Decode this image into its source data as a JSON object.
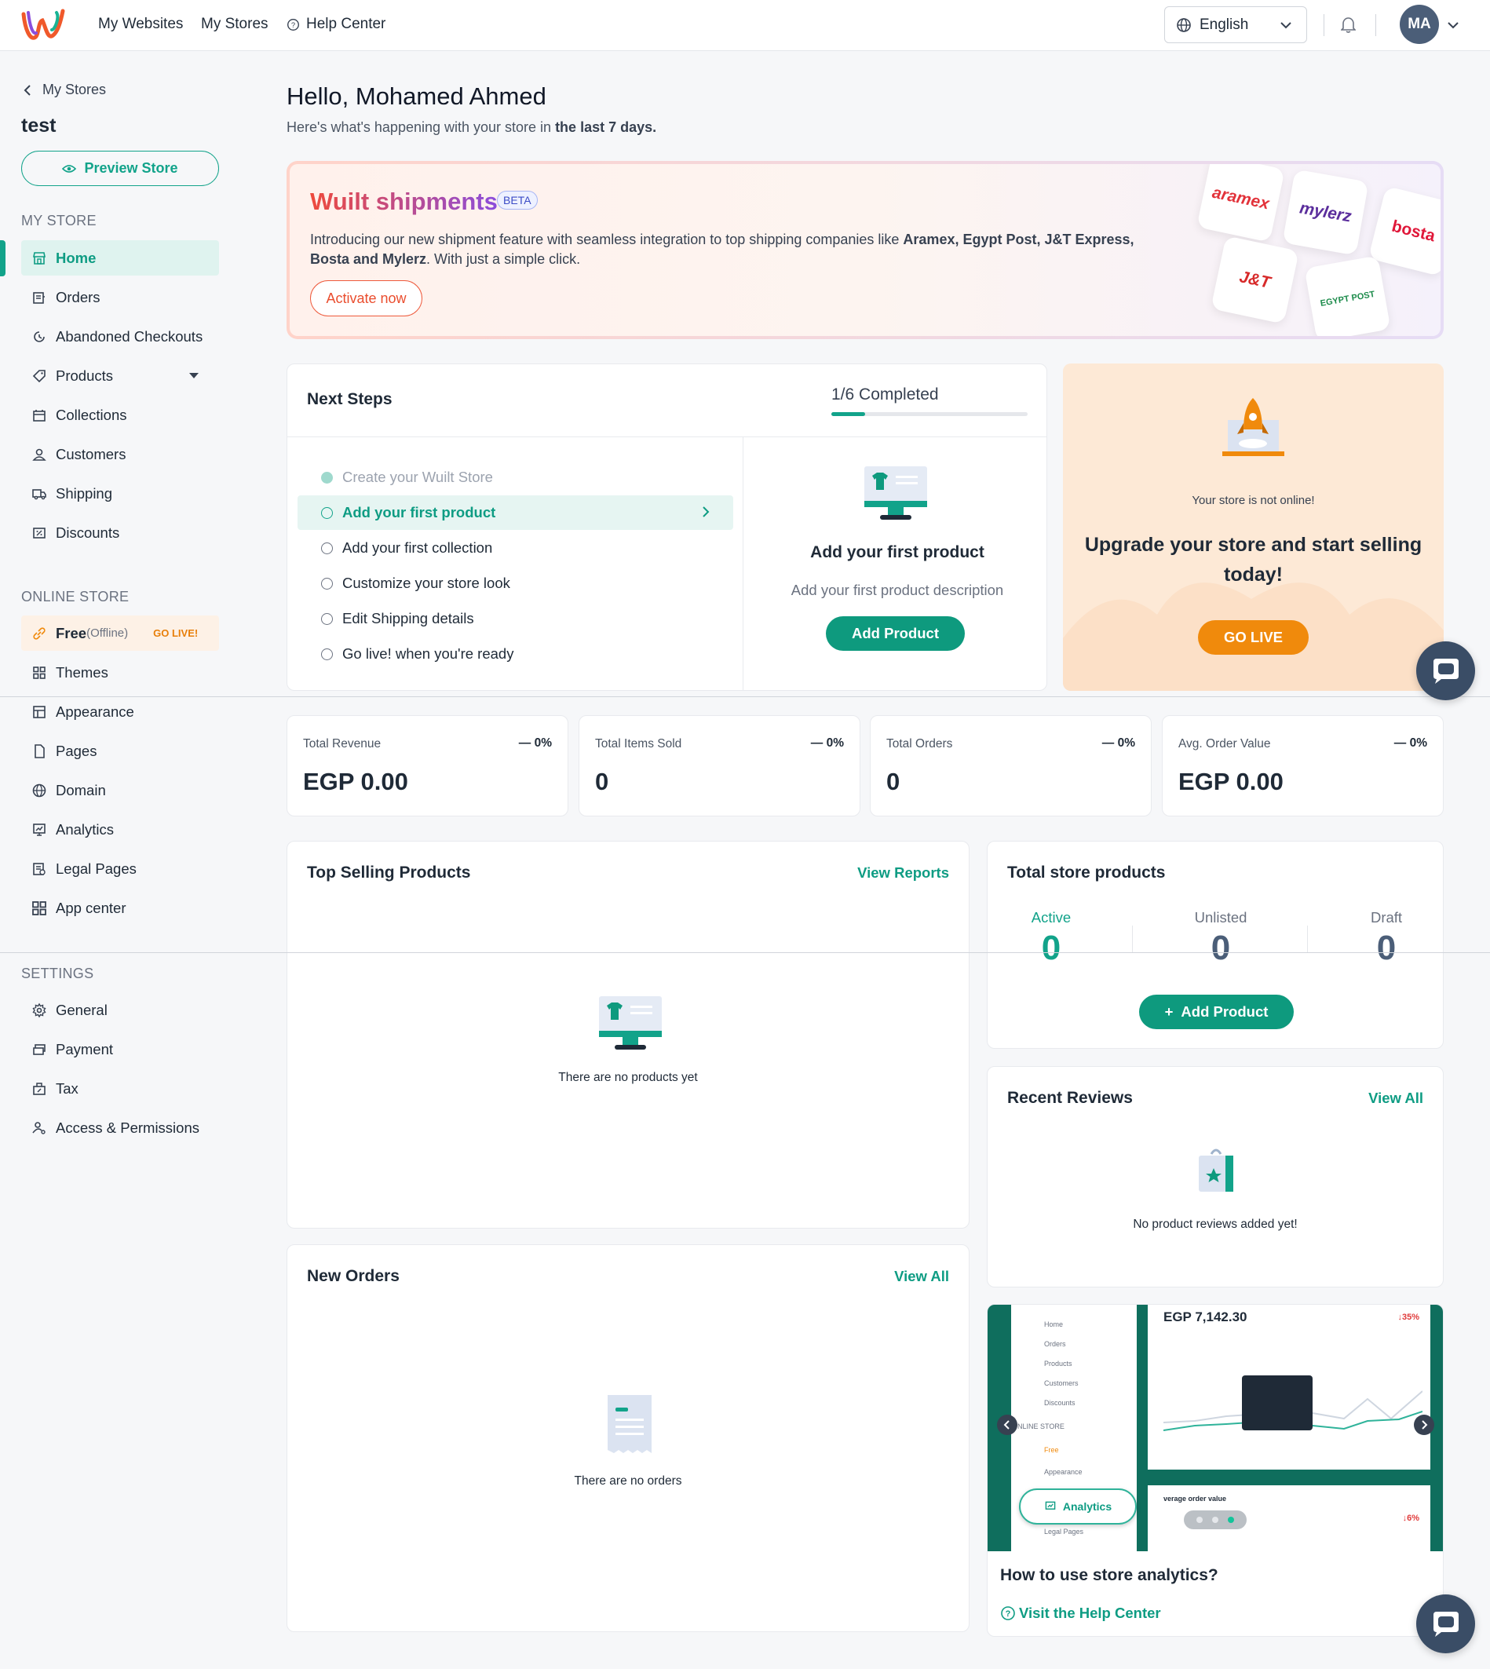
{
  "topbar": {
    "nav": [
      "My Websites",
      "My Stores",
      "Help Center"
    ],
    "language": "English",
    "avatar_initials": "MA"
  },
  "sidebar": {
    "back_label": "My Stores",
    "store_name": "test",
    "preview_label": "Preview Store",
    "my_store_heading": "MY STORE",
    "online_store_heading": "ONLINE STORE",
    "settings_heading": "SETTINGS",
    "my_store": [
      "Home",
      "Orders",
      "Abandoned Checkouts",
      "Products",
      "Collections",
      "Customers",
      "Shipping",
      "Discounts"
    ],
    "free_label": "Free",
    "offline_label": "(Offline)",
    "go_live_badge": "GO LIVE!",
    "online_store": [
      "Themes",
      "Appearance",
      "Pages",
      "Domain",
      "Analytics",
      "Legal Pages",
      "App center"
    ],
    "settings": [
      "General",
      "Payment",
      "Tax",
      "Access & Permissions"
    ]
  },
  "greeting": {
    "title": "Hello, Mohamed Ahmed",
    "sub_prefix": "Here's what's happening with your store in ",
    "sub_bold": "the last 7 days."
  },
  "banner": {
    "title": "Wuilt shipments",
    "badge": "BETA",
    "desc_prefix": "Introducing our new shipment feature with seamless integration to top shipping companies like ",
    "desc_bold": "Aramex, Egypt Post, J&T Express, Bosta and Mylerz",
    "desc_suffix": ". With just a simple click.",
    "button": "Activate now",
    "logos": [
      "aramex",
      "mylerz",
      "bosta",
      "J&T",
      "EGYPT POST"
    ]
  },
  "next_steps": {
    "title": "Next Steps",
    "completed": "1/6 Completed",
    "progress": 0.17,
    "steps": [
      "Create your Wuilt Store",
      "Add your first product",
      "Add your first collection",
      "Customize your store look",
      "Edit Shipping details",
      "Go live! when you're ready"
    ],
    "detail_title": "Add your first product",
    "detail_desc": "Add your first product description",
    "detail_button": "Add Product"
  },
  "golive": {
    "small": "Your store is not online!",
    "big": "Upgrade your store and start selling today!",
    "button": "GO LIVE"
  },
  "kpis": [
    {
      "title": "Total Revenue",
      "pct": "0%",
      "value": "EGP 0.00"
    },
    {
      "title": "Total Items Sold",
      "pct": "0%",
      "value": "0"
    },
    {
      "title": "Total Orders",
      "pct": "0%",
      "value": "0"
    },
    {
      "title": "Avg. Order Value",
      "pct": "0%",
      "value": "EGP 0.00"
    }
  ],
  "top_selling": {
    "title": "Top Selling Products",
    "link": "View Reports",
    "empty": "There are no products yet"
  },
  "store_products": {
    "title": "Total store products",
    "labels": [
      "Active",
      "Unlisted",
      "Draft"
    ],
    "values": [
      "0",
      "0",
      "0"
    ],
    "button": "Add Product"
  },
  "reviews": {
    "title": "Recent Reviews",
    "link": "View All",
    "empty": "No product reviews added yet!"
  },
  "new_orders": {
    "title": "New Orders",
    "link": "View All",
    "empty": "There are no orders"
  },
  "promo": {
    "question": "How to use store analytics?",
    "link": "Visit the Help Center",
    "preview_amount": "EGP 7,142.30",
    "preview_change": "↓35%",
    "preview_change2": "↓6%",
    "preview_label": "Analytics",
    "preview_avg": "verage order value",
    "preview_menu": [
      "Home",
      "Orders",
      "Products",
      "Customers",
      "Discounts"
    ],
    "preview_section": "NLINE STORE",
    "preview_free": "Free",
    "preview_bottom": [
      "Appearance",
      "Legal Pages"
    ]
  },
  "colors": {
    "accent": "#12a38a",
    "orange": "#f08a0c",
    "banner_red": "#ee4a3c"
  }
}
